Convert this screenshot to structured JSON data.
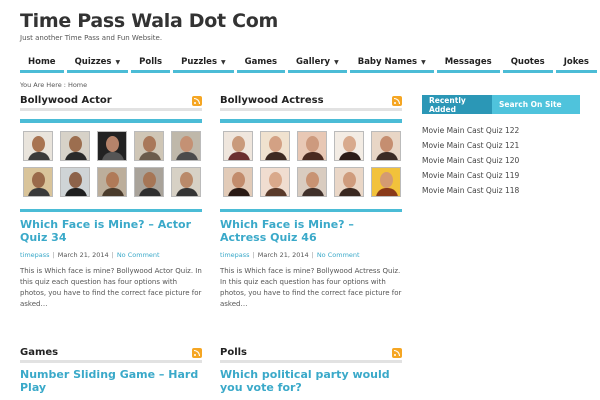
{
  "site": {
    "title": "Time Pass Wala Dot Com",
    "tagline": "Just another Time Pass and Fun Website."
  },
  "nav": [
    {
      "label": "Home",
      "dropdown": false
    },
    {
      "label": "Quizzes",
      "dropdown": true
    },
    {
      "label": "Polls",
      "dropdown": false
    },
    {
      "label": "Puzzles",
      "dropdown": true
    },
    {
      "label": "Games",
      "dropdown": false
    },
    {
      "label": "Gallery",
      "dropdown": true
    },
    {
      "label": "Baby Names",
      "dropdown": true
    },
    {
      "label": "Messages",
      "dropdown": false
    },
    {
      "label": "Quotes",
      "dropdown": false
    },
    {
      "label": "Jokes",
      "dropdown": false
    }
  ],
  "breadcrumb": {
    "prefix": "You Are Here",
    "separator": ":",
    "current": "Home"
  },
  "columns": {
    "actor": {
      "heading": "Bollywood Actor",
      "post_title": "Which Face is Mine? – Actor Quiz 34",
      "author": "timepass",
      "date": "March 21, 2014",
      "comments": "No Comment",
      "excerpt": "This is Which face is mine? Bollywood Actor Quiz. In this quiz each question has four options with photos, you have to find the correct face picture for asked…"
    },
    "actress": {
      "heading": "Bollywood Actress",
      "post_title": "Which Face is Mine? – Actress Quiz 46",
      "author": "timepass",
      "date": "March 21, 2014",
      "comments": "No Comment",
      "excerpt": "This is Which face is mine? Bollywood Actress Quiz. In this quiz each question has four options with photos, you have to find the correct face picture for asked…"
    },
    "games": {
      "heading": "Games",
      "post_title": "Number Sliding Game – Hard Play"
    },
    "polls": {
      "heading": "Polls",
      "post_title": "Which political party would you vote for?"
    }
  },
  "sidebar": {
    "tab_active": "Recently Added",
    "tab_inactive": "Search On Site",
    "recent": [
      "Movie Main Cast Quiz 122",
      "Movie Main Cast Quiz 121",
      "Movie Main Cast Quiz 120",
      "Movie Main Cast Quiz 119",
      "Movie Main Cast Quiz 118"
    ]
  },
  "colors": {
    "accent": "#4bbcd6",
    "link": "#3aa9c9",
    "tab_active": "#2b97b6",
    "rss": "#f5a623"
  },
  "icons": {
    "feed": "rss-icon",
    "dropdown": "caret-down-icon"
  }
}
